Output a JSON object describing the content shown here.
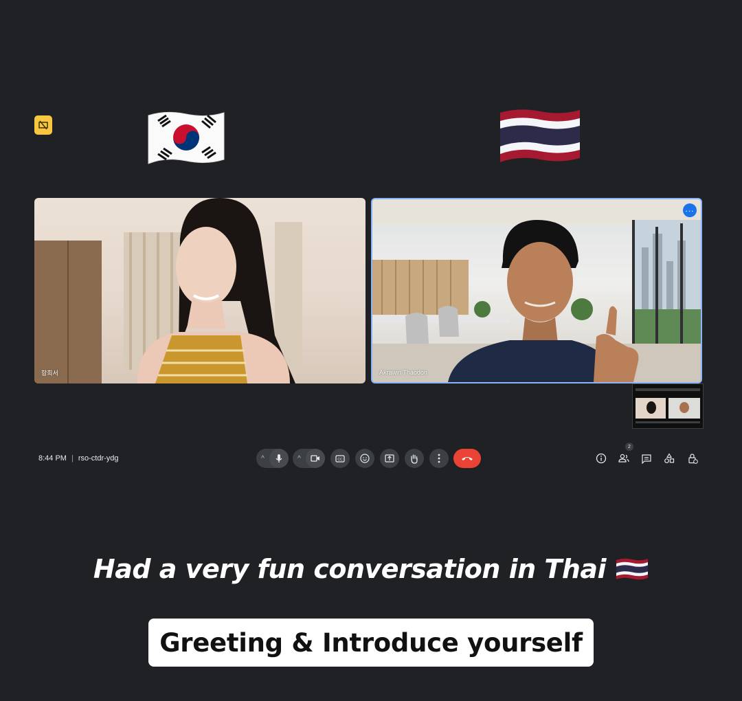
{
  "flags": {
    "left": "south-korea-flag",
    "right": "thailand-flag"
  },
  "participants": [
    {
      "name": "항희서"
    },
    {
      "name": "Akrawin Thaodon"
    }
  ],
  "meeting": {
    "time": "8:44 PM",
    "code": "rso-ctdr-ydg"
  },
  "controls": {
    "participant_count": "2",
    "icons": [
      "mic-icon",
      "camera-icon",
      "captions-icon",
      "emoji-icon",
      "present-icon",
      "raise-hand-icon",
      "more-options-icon",
      "end-call-icon",
      "info-icon",
      "people-icon",
      "chat-icon",
      "activities-icon",
      "host-controls-icon"
    ]
  },
  "caption": {
    "text": "Had a very fun conversation in Thai"
  },
  "topic": {
    "text": "Greeting & Introduce yourself"
  },
  "colors": {
    "background": "#202124",
    "accent_blue": "#1a73e8",
    "active_border": "#8ab4f8",
    "end_call_red": "#ea4335",
    "badge_yellow": "#f9c642"
  }
}
